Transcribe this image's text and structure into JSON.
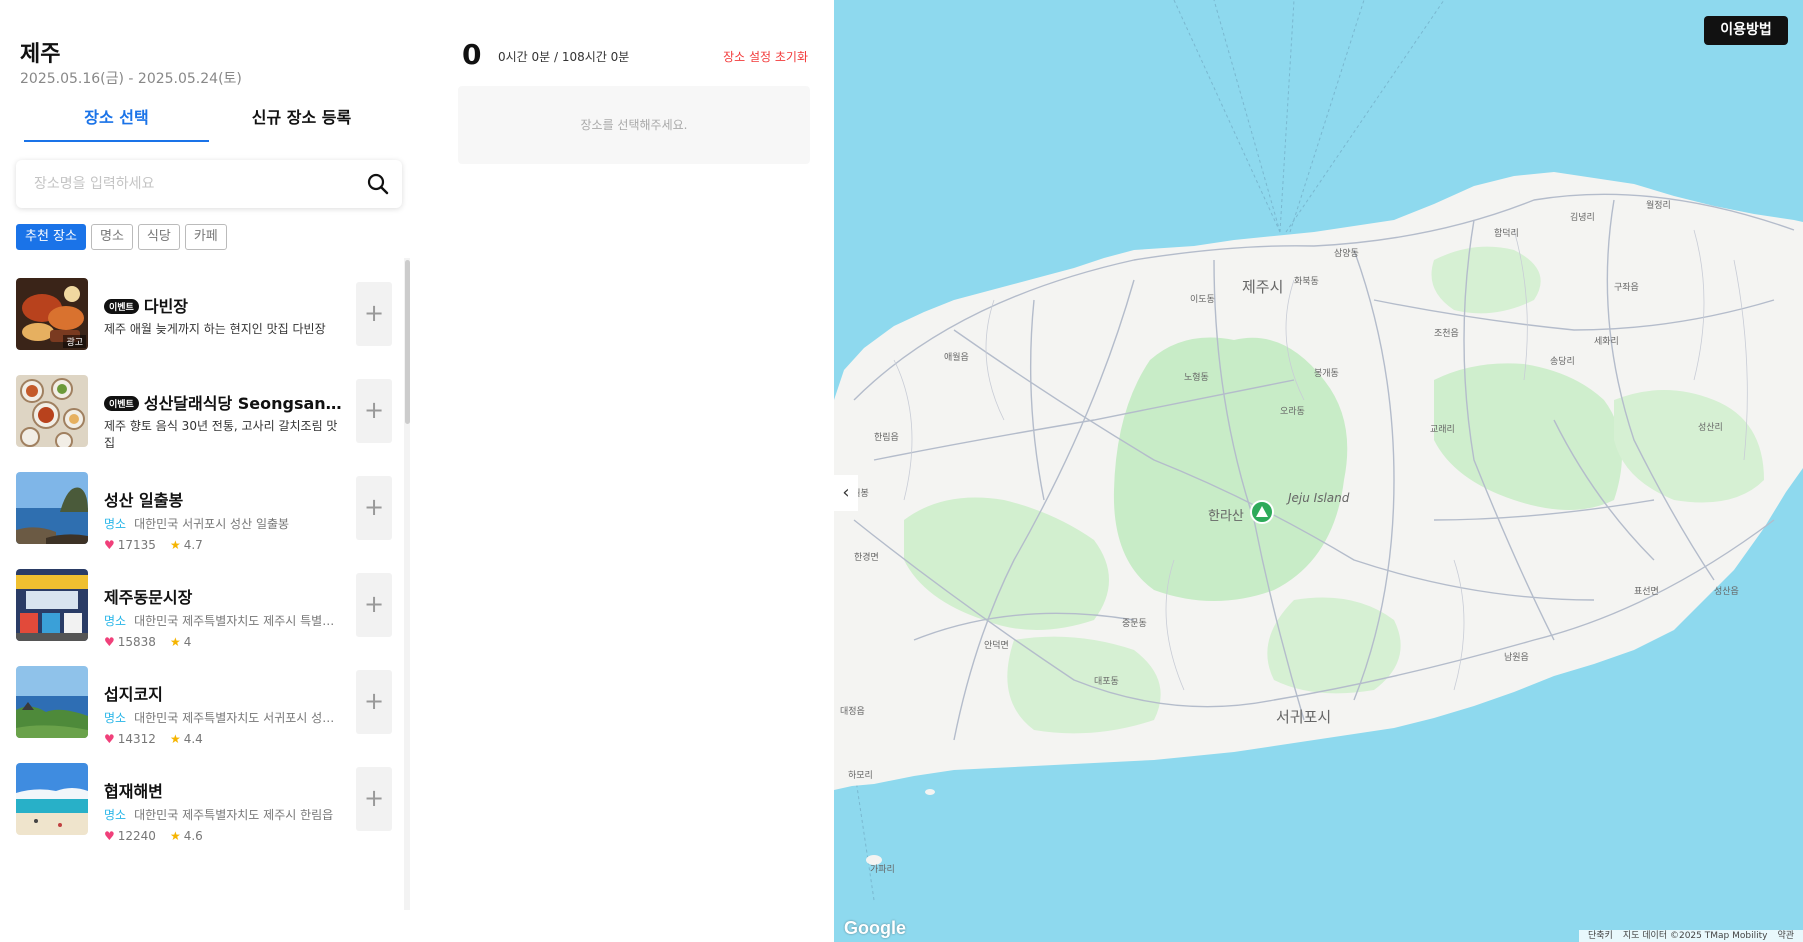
{
  "trip": {
    "city": "제주",
    "dates": "2025.05.16(금) - 2025.05.24(토)"
  },
  "tabs": {
    "select": "장소 선택",
    "register": "신규 장소 등록"
  },
  "search": {
    "placeholder": "장소명을 입력하세요"
  },
  "chips": [
    "추천 장소",
    "명소",
    "식당",
    "카페"
  ],
  "places": [
    {
      "badge": "이벤트",
      "name": "다빈장",
      "description": "제주 애월 늦게까지 하는 현지인 맛집 다빈장",
      "ad_label": "광고"
    },
    {
      "badge": "이벤트",
      "name": "성산달래식당 Seongsan Dallae Restaurant",
      "description": "제주 향토 음식 30년 전통, 고사리 갈치조림 맛집"
    },
    {
      "name": "성산 일출봉",
      "category": "명소",
      "address": "대한민국 서귀포시 성산 일출봉",
      "likes": "17135",
      "rating": "4.7"
    },
    {
      "name": "제주동문시장",
      "category": "명소",
      "address": "대한민국 제주특별자치도 제주시 특별자치도",
      "likes": "15838",
      "rating": "4"
    },
    {
      "name": "섭지코지",
      "category": "명소",
      "address": "대한민국 제주특별자치도 서귀포시 성산읍",
      "likes": "14312",
      "rating": "4.4"
    },
    {
      "name": "협재해변",
      "category": "명소",
      "address": "대한민국 제주특별자치도 제주시 한림읍",
      "likes": "12240",
      "rating": "4.6"
    }
  ],
  "schedule": {
    "count": "0",
    "time": "0시간 0분 / 108시간 0분",
    "reset_label": "장소 설정 초기화",
    "empty_message": "장소를 선택해주세요."
  },
  "map": {
    "help_label": "이용방법",
    "google_logo": "Google",
    "attribution": [
      "단축키",
      "지도 데이터 ©2025 TMap Mobility",
      "약관"
    ],
    "labels": {
      "jeju_si": "제주시",
      "seogwipo_si": "서귀포시",
      "hallasan": "한라산",
      "jeju_island": "Jeju Island",
      "aewol": "애월읍",
      "hallim": "한림읍",
      "hangyeong": "한경면",
      "daejeong": "대정읍",
      "andeok": "안덕면",
      "jocheon": "조천읍",
      "gujwa": "구좌읍",
      "seongsan": "성산읍",
      "pyoseon": "표선면",
      "namwon": "남원읍",
      "gapado": "가파리",
      "hamori": "하모리",
      "hwabuk": "화북동",
      "samyang": "삼양동",
      "ido": "이도동",
      "nohyeong": "노형동",
      "ora": "오라동",
      "bongae": "봉개동",
      "jungmun": "중문동",
      "daepo": "대포동",
      "seongsanri": "성산리",
      "sehwa": "세화리",
      "hamdeok": "함덕리",
      "gimnyeong": "김녕리",
      "woljeong": "월정리",
      "songdang": "송당리",
      "gyorae": "교래리",
      "suwolbong": "수월봉"
    }
  }
}
